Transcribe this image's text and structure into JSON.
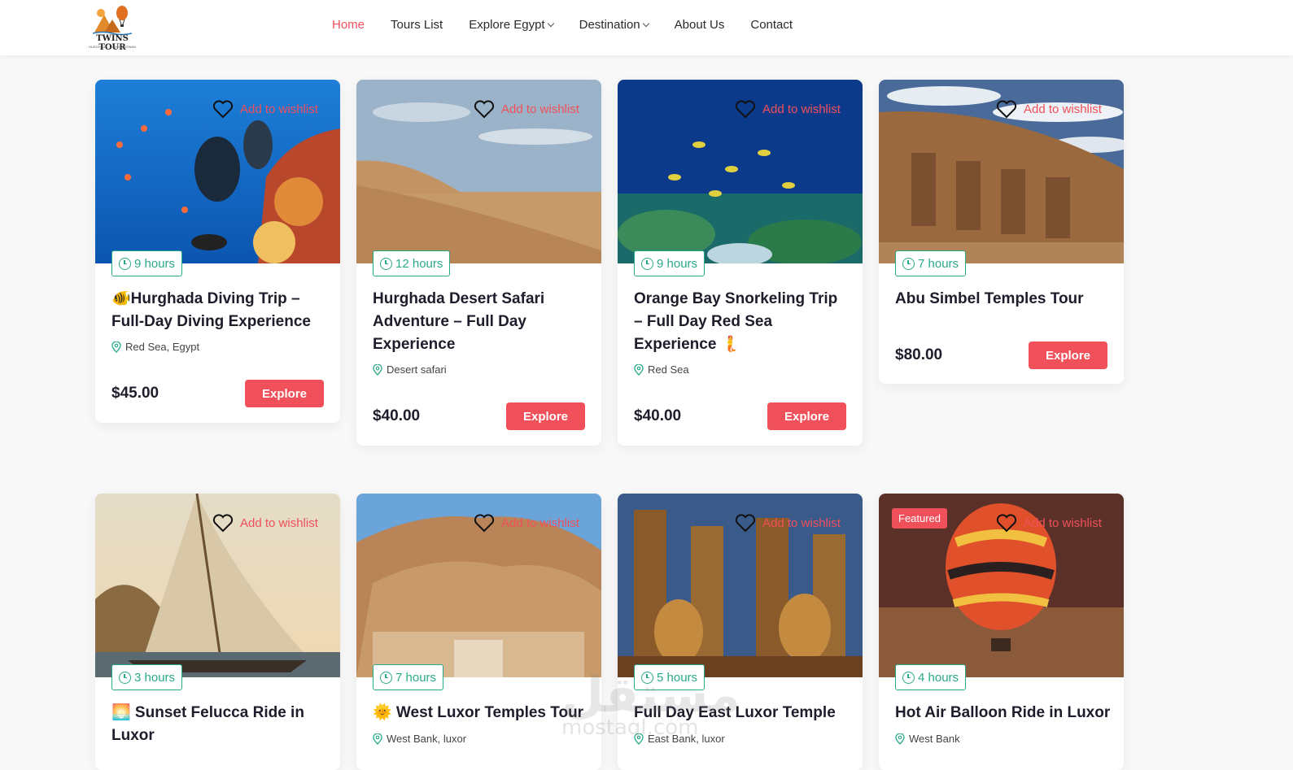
{
  "brand": {
    "name": "TWINS TOUR",
    "tagline": "HURGHADA - LUXOR - ASWAN"
  },
  "nav": [
    {
      "label": "Home",
      "active": true,
      "dropdown": false
    },
    {
      "label": "Tours List",
      "active": false,
      "dropdown": false
    },
    {
      "label": "Explore Egypt",
      "active": false,
      "dropdown": true
    },
    {
      "label": "Destination",
      "active": false,
      "dropdown": true
    },
    {
      "label": "About Us",
      "active": false,
      "dropdown": false
    },
    {
      "label": "Contact",
      "active": false,
      "dropdown": false
    }
  ],
  "wishlist_label": "Add to wishlist",
  "explore_label": "Explore",
  "featured_label": "Featured",
  "tours": [
    {
      "hours": "9 hours",
      "title": "🐠Hurghada Diving Trip – Full-Day Diving Experience",
      "location": "Red Sea, Egypt",
      "price": "$45.00"
    },
    {
      "hours": "12 hours",
      "title": "Hurghada Desert Safari Adventure – Full Day Experience",
      "location": "Desert safari",
      "price": "$40.00"
    },
    {
      "hours": "9 hours",
      "title": "Orange Bay Snorkeling Trip – Full Day Red Sea Experience 🧜",
      "location": "Red Sea",
      "price": "$40.00"
    },
    {
      "hours": "7 hours",
      "title": "Abu Simbel Temples Tour",
      "location": "",
      "price": "$80.00"
    },
    {
      "hours": "3 hours",
      "title": "🌅 Sunset Felucca Ride in Luxor",
      "location": "",
      "price": ""
    },
    {
      "hours": "7 hours",
      "title": "🌞 West Luxor Temples Tour",
      "location": "West Bank, luxor",
      "price": ""
    },
    {
      "hours": "5 hours",
      "title": "Full Day East Luxor Temple",
      "location": "East Bank, luxor",
      "price": ""
    },
    {
      "hours": "4 hours",
      "title": "Hot Air Balloon Ride in Luxor",
      "location": "West Bank",
      "price": ""
    }
  ],
  "watermark": {
    "text": "مستقل",
    "sub": "mostaql.com"
  },
  "colors": {
    "accent": "#f0505a",
    "teal": "#2aa98a"
  }
}
